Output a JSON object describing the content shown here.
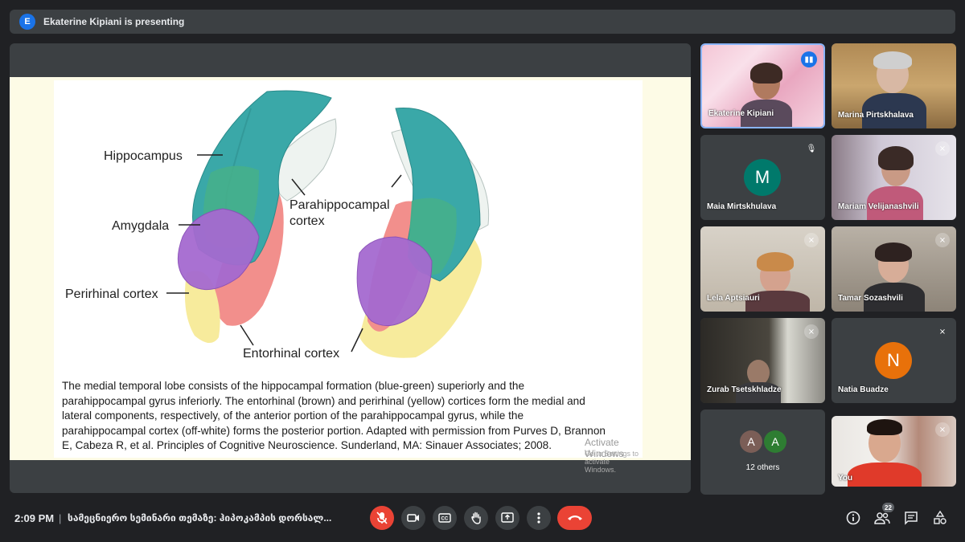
{
  "presenting_banner": {
    "initial": "E",
    "text": "Ekaterine Kipiani is presenting"
  },
  "slide": {
    "labels": {
      "hippocampus": "Hippocampus",
      "parahippocampal": "Parahippocampal",
      "cortex": "cortex",
      "amygdala": "Amygdala",
      "perirhinal": "Perirhinal cortex",
      "entorhinal": "Entorhinal cortex"
    },
    "caption_lines": [
      "The medial temporal lobe consists of the hippocampal formation (blue-green) superiorly and the",
      "parahippocampal gyrus inferiorly. The entorhinal (brown) and perirhinal (yellow) cortices form the medial and",
      "lateral components, respectively, of the anterior portion of the parahippocampal gyrus, while the",
      "parahippocampal cortex (off-white) forms the posterior portion. Adapted with permission from Purves D, Brannon",
      "E, Cabeza R, et al. Principles of Cognitive Neuroscience. Sunderland, MA: Sinauer Associates; 2008."
    ],
    "watermark_title": "Activate Windows",
    "watermark_sub": "Go to Settings to activate Windows."
  },
  "participants": [
    {
      "name": "Ekaterine Kipiani",
      "type": "video"
    },
    {
      "name": "Marina Pirtskhalava",
      "type": "video"
    },
    {
      "name": "Maia Mirtskhulava",
      "type": "avatar",
      "initial": "M",
      "color": "#00796b"
    },
    {
      "name": "Mariam Velijanashvili",
      "type": "video"
    },
    {
      "name": "Lela Aptsiauri",
      "type": "video"
    },
    {
      "name": "Tamar Sozashvili",
      "type": "video"
    },
    {
      "name": "Zurab Tsetskhladze",
      "type": "video"
    },
    {
      "name": "Natia Buadze",
      "type": "avatar",
      "initial": "N",
      "color": "#e8710a"
    },
    {
      "name": "You",
      "type": "video"
    }
  ],
  "others": {
    "label": "12 others",
    "avatars": [
      {
        "initial": "A",
        "color": "#7b5e57"
      },
      {
        "initial": "A",
        "color": "#2e7d32"
      }
    ]
  },
  "bottom": {
    "time": "2:09 PM",
    "separator": "|",
    "meeting_title": "სამეცნიერო სემინარი თემაზე: ჰიპოკამპის დორსალ...",
    "people_count": "22"
  },
  "icons": {
    "mic": "mic-off-icon",
    "camera": "camera-icon",
    "captions": "captions-icon",
    "hand": "raise-hand-icon",
    "present": "present-icon",
    "more": "more-options-icon",
    "end": "end-call-icon",
    "info": "info-icon",
    "people": "people-icon",
    "chat": "chat-icon",
    "activities": "activities-icon"
  },
  "colors": {
    "end_call": "#ea4335",
    "active_speaker": "#1a73e8"
  }
}
